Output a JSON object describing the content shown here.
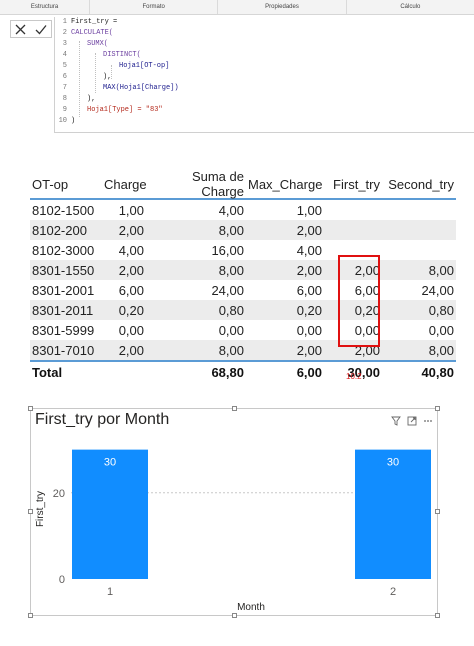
{
  "ribbon": {
    "tabs": [
      "Estructura",
      "Formato",
      "Propiedades",
      "Cálculo"
    ]
  },
  "formula": {
    "lines": [
      {
        "n": "1",
        "text": "First_try =",
        "kind": "txt"
      },
      {
        "n": "2",
        "text": "CALCULATE(",
        "kind": "fn"
      },
      {
        "n": "3",
        "text": "SUMX(",
        "kind": "fn"
      },
      {
        "n": "4",
        "text": "DISTINCT(",
        "kind": "fn"
      },
      {
        "n": "5",
        "text": "Hoja1[OT-op]",
        "kind": "col"
      },
      {
        "n": "6",
        "text": "),",
        "kind": "txt"
      },
      {
        "n": "7",
        "text": "MAX(Hoja1[Charge])",
        "kind": "col"
      },
      {
        "n": "8",
        "text": "),",
        "kind": "txt"
      },
      {
        "n": "9",
        "text": "Hoja1[Type] = \"83\"",
        "kind": "str"
      },
      {
        "n": "10",
        "text": ")",
        "kind": "txt"
      }
    ]
  },
  "table": {
    "headers": [
      "OT-op",
      "Charge",
      "Suma de Charge",
      "Max_Charge",
      "First_try",
      "Second_try"
    ],
    "rows": [
      [
        "8102-1500",
        "1,00",
        "4,00",
        "1,00",
        "",
        ""
      ],
      [
        "8102-200",
        "2,00",
        "8,00",
        "2,00",
        "",
        ""
      ],
      [
        "8102-3000",
        "4,00",
        "16,00",
        "4,00",
        "",
        ""
      ],
      [
        "8301-1550",
        "2,00",
        "8,00",
        "2,00",
        "2,00",
        "8,00"
      ],
      [
        "8301-2001",
        "6,00",
        "24,00",
        "6,00",
        "6,00",
        "24,00"
      ],
      [
        "8301-2011",
        "0,20",
        "0,80",
        "0,20",
        "0,20",
        "0,80"
      ],
      [
        "8301-5999",
        "0,00",
        "0,00",
        "0,00",
        "0,00",
        "0,00"
      ],
      [
        "8301-7010",
        "2,00",
        "8,00",
        "2,00",
        "2,00",
        "8,00"
      ]
    ],
    "total": [
      "Total",
      "",
      "68,80",
      "6,00",
      "30,00",
      "40,80"
    ],
    "note": "10.2",
    "accent": "#5b9bd5",
    "highlight": "#e01010"
  },
  "chart_data": {
    "type": "bar",
    "title": "First_try por Month",
    "xlabel": "Month",
    "ylabel": "First_try",
    "categories": [
      "1",
      "2"
    ],
    "values": [
      30,
      30
    ],
    "data_labels": [
      "30",
      "30"
    ],
    "yticks": [
      "0",
      "20"
    ],
    "ylim": [
      0,
      32
    ],
    "grid": true,
    "bar_color": "#118dff"
  },
  "icons": [
    "close-icon",
    "check-icon",
    "filter-icon",
    "focus-mode-icon",
    "more-options-icon"
  ]
}
